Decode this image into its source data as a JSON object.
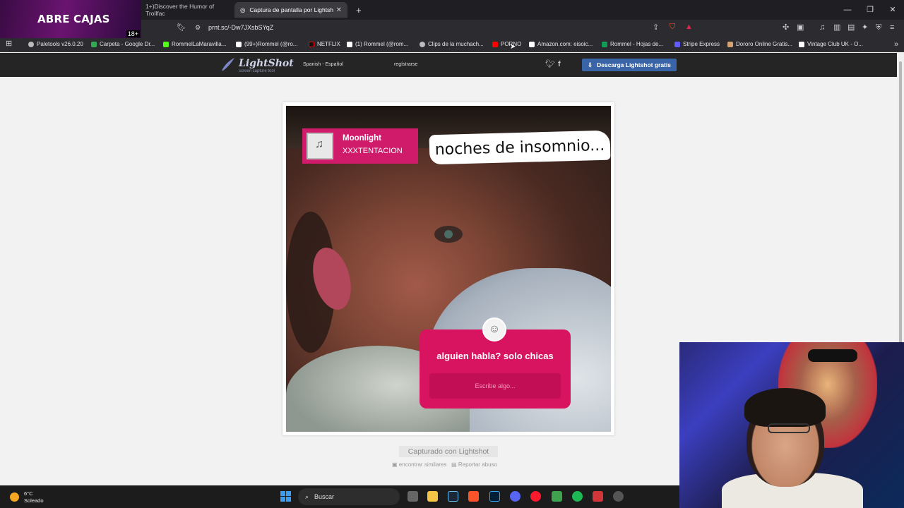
{
  "overlay": {
    "title": "ABRE CAJAS",
    "badge": "18+"
  },
  "tabs": [
    {
      "label": "1+)Discover the Humor of Trollfac"
    },
    {
      "label": "Captura de pantalla por Lightsh"
    }
  ],
  "address": {
    "url": "prnt.sc/-Dw7JXsbSYqZ"
  },
  "bookmarks": [
    {
      "label": "Paletools v26.0.20",
      "color": "#bbbbbb"
    },
    {
      "label": "Carpeta - Google Dr...",
      "color": "#34a853"
    },
    {
      "label": "RommelLaMaravilla...",
      "color": "#53fc18"
    },
    {
      "label": "(99+)Rommel (@ro...",
      "color": "#ffffff"
    },
    {
      "label": "NETFLIX",
      "color": "#e50914"
    },
    {
      "label": "(1) Rommel (@rom...",
      "color": "#ffffff"
    },
    {
      "label": "Clips de la muchach...",
      "color": "#bbbbbb"
    },
    {
      "label": "PORNO",
      "color": "#ff0000"
    },
    {
      "label": "Amazon.com: eisoic...",
      "color": "#ffffff"
    },
    {
      "label": "Rommel - Hojas de...",
      "color": "#0f9d58"
    },
    {
      "label": "Stripe Express",
      "color": "#635bff"
    },
    {
      "label": "Dororo Online Gratis...",
      "color": "#d4a373"
    },
    {
      "label": "Vintage Club UK - O...",
      "color": "#ffffff"
    }
  ],
  "lightshot": {
    "logo_name": "LightShot",
    "logo_tagline": "screen capture tool",
    "language": "Spanish - Español",
    "register": "regístrarse",
    "download": "Descarga Lightshot gratis",
    "captured": "Capturado con Lightshot",
    "find_similar": "encontrar similares",
    "report": "Reportar abuso"
  },
  "screenshot": {
    "song": "Moonlight",
    "artist": "XXXTENTACION",
    "caption": "noches de insomnio...",
    "question": "alguien habla? solo chicas",
    "input_placeholder": "Escribe algo..."
  },
  "taskbar": {
    "temperature": "6°C",
    "weather": "Soleado",
    "search": "Buscar"
  }
}
